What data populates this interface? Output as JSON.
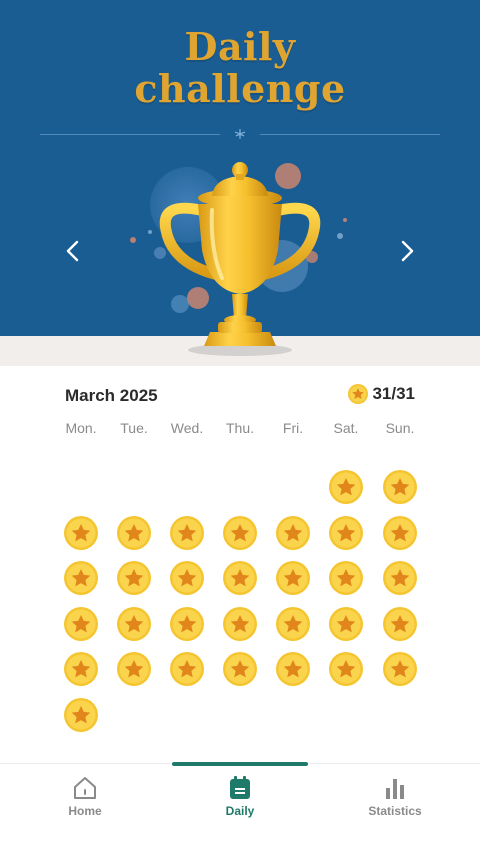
{
  "header": {
    "title_line1": "Daily",
    "title_line2": "challenge"
  },
  "calendar": {
    "month": "March 2025",
    "score": "31/31",
    "weekdays": [
      "Mon.",
      "Tue.",
      "Wed.",
      "Thu.",
      "Fri.",
      "Sat.",
      "Sun."
    ],
    "first_weekday_index": 5,
    "days_in_month": 31,
    "completed_days": 31
  },
  "bottom_nav": {
    "items": [
      {
        "label": "Home",
        "icon": "home-icon",
        "active": false
      },
      {
        "label": "Daily",
        "icon": "calendar-icon",
        "active": true
      },
      {
        "label": "Statistics",
        "icon": "bar-chart-icon",
        "active": false
      }
    ]
  },
  "colors": {
    "hero_bg": "#1a5d92",
    "title": "#e0a530",
    "accent": "#1f7a6a",
    "coin": "#f5c530",
    "star": "#e0861a"
  }
}
